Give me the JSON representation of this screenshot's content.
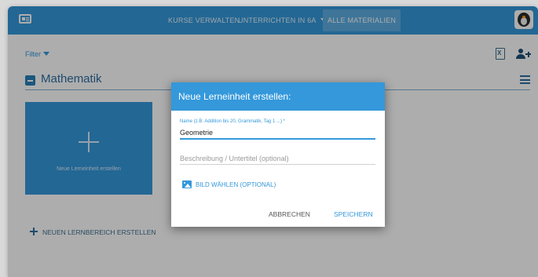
{
  "topbar": {
    "app_icon": "id-card-icon",
    "nav_kurse": "KURSE VERWALTEN",
    "nav_unterrichten": "UNTERRICHTEN IN 6A",
    "nav_alle": "ALLE MATERIALIEN",
    "avatar_icon": "penguin-avatar-icon"
  },
  "toolbar": {
    "filter_label": "Filter",
    "excel_icon": "excel-export-icon",
    "excel_letter": "X",
    "add_user_icon": "add-user-icon"
  },
  "section": {
    "title": "Mathematik",
    "collapse_icon": "minus-square-icon",
    "menu_icon": "hamburger-menu-icon"
  },
  "card": {
    "label": "Neue Lerneinheit erstellen",
    "icon": "plus-icon"
  },
  "new_area_button": "NEUEN LERNBEREICH ERSTELLEN",
  "dialog": {
    "title": "Neue Lerneinheit erstellen:",
    "name_label": "Name (z.B. Addition bis 20, Grammatik, Tag 1 ...) *",
    "name_value": "Geometrie",
    "description_placeholder": "Beschreibung / Untertitel (optional)",
    "image_button": "BILD WÄHLEN (OPTIONAL)",
    "image_icon": "image-icon",
    "cancel_button": "ABBRECHEN",
    "save_button": "SPEICHERN"
  },
  "colors": {
    "primary": "#3498db",
    "primary_dark": "#2d6fa3",
    "overlay": "rgba(0,0,0,0.32)"
  }
}
